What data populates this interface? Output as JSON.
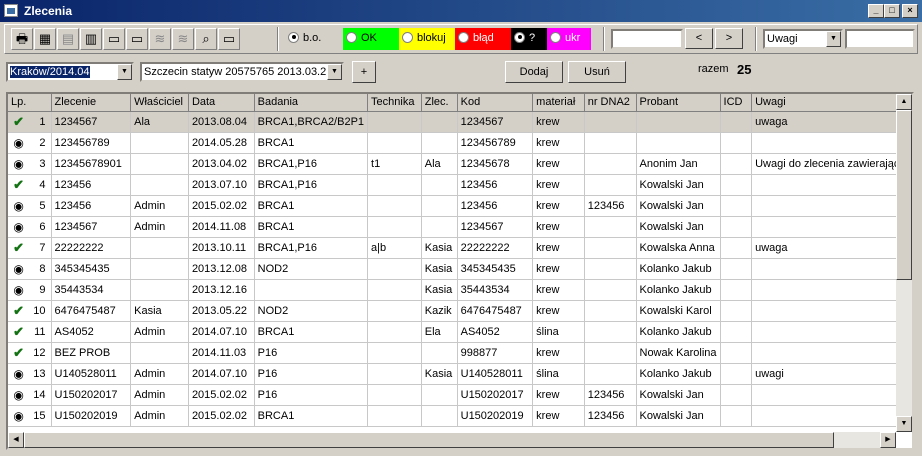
{
  "window": {
    "title": "Zlecenia"
  },
  "toolbar": {
    "icons": [
      "printer-icon",
      "calculator-icon",
      "document-icon",
      "bar-chart-icon",
      "open-folder-icon",
      "folder-arrow-icon",
      "dna-icon",
      "dna-arrow-icon",
      "magnifier-icon",
      "card-icon"
    ],
    "status_filters": [
      {
        "label": "b.o.",
        "color": "#d4d0c8",
        "text_color": "#000000",
        "checked": true
      },
      {
        "label": "OK",
        "color": "#00ff00",
        "text_color": "#000000",
        "checked": false
      },
      {
        "label": "blokuj",
        "color": "#ffff00",
        "text_color": "#000000",
        "checked": false
      },
      {
        "label": "błąd",
        "color": "#ff0000",
        "text_color": "#ffffff",
        "checked": false
      },
      {
        "label": "?",
        "color": "#000000",
        "text_color": "#ffffff",
        "checked": false
      },
      {
        "label": "ukr",
        "color": "#ff00ff",
        "text_color": "#ffffff",
        "checked": false
      }
    ],
    "prev_label": "<",
    "next_label": ">",
    "remarks_combo": "Uwagi"
  },
  "filters": {
    "location_combo": "Kraków/2014.04",
    "series_combo": "Szczecin statyw 20575765 2013.03.21",
    "plus_label": "+",
    "add_label": "Dodaj",
    "remove_label": "Usuń",
    "total_label": "razem",
    "total_value": "25"
  },
  "table": {
    "columns": [
      "Lp.",
      "Zlecenie",
      "Właściciel",
      "Data",
      "Badania",
      "Technika",
      "Zlec.",
      "Kod",
      "materiał",
      "nr DNA2",
      "Probant",
      "ICD",
      "Uwagi"
    ],
    "rows": [
      {
        "mark": "check",
        "lp": "1",
        "zlecenie": "1234567",
        "wlasciciel": "Ala",
        "data": "2013.08.04",
        "badania": "BRCA1,BRCA2/B2P1",
        "technika": "",
        "zlec": "",
        "kod": "1234567",
        "material": "krew",
        "dna2": "",
        "probant": "",
        "icd": "",
        "uwagi": "uwaga"
      },
      {
        "mark": "dot",
        "lp": "2",
        "zlecenie": "123456789",
        "wlasciciel": "",
        "data": "2014.05.28",
        "badania": "BRCA1",
        "technika": "",
        "zlec": "",
        "kod": "123456789",
        "material": "krew",
        "dna2": "",
        "probant": "",
        "icd": "",
        "uwagi": ""
      },
      {
        "mark": "dot",
        "lp": "3",
        "zlecenie": "12345678901",
        "wlasciciel": "",
        "data": "2013.04.02",
        "badania": "BRCA1,P16",
        "technika": "t1",
        "zlec": "Ala",
        "kod": "12345678",
        "material": "krew",
        "dna2": "",
        "probant": "Anonim Jan",
        "icd": "",
        "uwagi": "Uwagi do zlecenia zawierające"
      },
      {
        "mark": "check",
        "lp": "4",
        "zlecenie": "123456",
        "wlasciciel": "",
        "data": "2013.07.10",
        "badania": "BRCA1,P16",
        "technika": "",
        "zlec": "",
        "kod": "123456",
        "material": "krew",
        "dna2": "",
        "probant": "Kowalski Jan",
        "icd": "",
        "uwagi": ""
      },
      {
        "mark": "dot",
        "lp": "5",
        "zlecenie": "123456",
        "wlasciciel": "Admin",
        "data": "2015.02.02",
        "badania": "BRCA1",
        "technika": "",
        "zlec": "",
        "kod": "123456",
        "material": "krew",
        "dna2": "123456",
        "probant": "Kowalski Jan",
        "icd": "",
        "uwagi": ""
      },
      {
        "mark": "dot",
        "lp": "6",
        "zlecenie": "1234567",
        "wlasciciel": "Admin",
        "data": "2014.11.08",
        "badania": "BRCA1",
        "technika": "",
        "zlec": "",
        "kod": "1234567",
        "material": "krew",
        "dna2": "",
        "probant": "Kowalski Jan",
        "icd": "",
        "uwagi": ""
      },
      {
        "mark": "check",
        "lp": "7",
        "zlecenie": "22222222",
        "wlasciciel": "",
        "data": "2013.10.11",
        "badania": "BRCA1,P16",
        "technika": "a|b",
        "zlec": "Kasia",
        "kod": "22222222",
        "material": "krew",
        "dna2": "",
        "probant": "Kowalska Anna",
        "icd": "",
        "uwagi": "uwaga"
      },
      {
        "mark": "dot",
        "lp": "8",
        "zlecenie": "345345435",
        "wlasciciel": "",
        "data": "2013.12.08",
        "badania": "NOD2",
        "technika": "",
        "zlec": "Kasia",
        "kod": "345345435",
        "material": "krew",
        "dna2": "",
        "probant": "Kolanko Jakub",
        "icd": "",
        "uwagi": ""
      },
      {
        "mark": "dot",
        "lp": "9",
        "zlecenie": "35443534",
        "wlasciciel": "",
        "data": "2013.12.16",
        "badania": "",
        "technika": "",
        "zlec": "Kasia",
        "kod": "35443534",
        "material": "krew",
        "dna2": "",
        "probant": "Kolanko Jakub",
        "icd": "",
        "uwagi": ""
      },
      {
        "mark": "check",
        "lp": "10",
        "zlecenie": "6476475487",
        "wlasciciel": "Kasia",
        "data": "2013.05.22",
        "badania": "NOD2",
        "technika": "",
        "zlec": "Kazik",
        "kod": "6476475487",
        "material": "krew",
        "dna2": "",
        "probant": "Kowalski Karol",
        "icd": "",
        "uwagi": ""
      },
      {
        "mark": "check",
        "lp": "11",
        "zlecenie": "AS4052",
        "wlasciciel": "Admin",
        "data": "2014.07.10",
        "badania": "BRCA1",
        "technika": "",
        "zlec": "Ela",
        "kod": "AS4052",
        "material": "ślina",
        "dna2": "",
        "probant": "Kolanko Jakub",
        "icd": "",
        "uwagi": ""
      },
      {
        "mark": "check",
        "lp": "12",
        "zlecenie": "BEZ PROB",
        "wlasciciel": "",
        "data": "2014.11.03",
        "badania": "P16",
        "technika": "",
        "zlec": "",
        "kod": "998877",
        "material": "krew",
        "dna2": "",
        "probant": "Nowak Karolina",
        "icd": "",
        "uwagi": ""
      },
      {
        "mark": "dot",
        "lp": "13",
        "zlecenie": "U140528011",
        "wlasciciel": "Admin",
        "data": "2014.07.10",
        "badania": "P16",
        "technika": "",
        "zlec": "Kasia",
        "kod": "U140528011",
        "material": "ślina",
        "dna2": "",
        "probant": "Kolanko Jakub",
        "icd": "",
        "uwagi": "uwagi"
      },
      {
        "mark": "dot",
        "lp": "14",
        "zlecenie": "U150202017",
        "wlasciciel": "Admin",
        "data": "2015.02.02",
        "badania": "P16",
        "technika": "",
        "zlec": "",
        "kod": "U150202017",
        "material": "krew",
        "dna2": "123456",
        "probant": "Kowalski Jan",
        "icd": "",
        "uwagi": ""
      },
      {
        "mark": "dot",
        "lp": "15",
        "zlecenie": "U150202019",
        "wlasciciel": "Admin",
        "data": "2015.02.02",
        "badania": "BRCA1",
        "technika": "",
        "zlec": "",
        "kod": "U150202019",
        "material": "krew",
        "dna2": "123456",
        "probant": "Kowalski Jan",
        "icd": "",
        "uwagi": ""
      }
    ]
  }
}
